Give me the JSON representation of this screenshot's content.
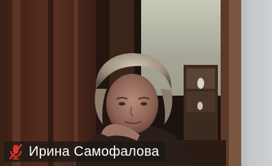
{
  "participant": {
    "name": "Ирина Самофалова",
    "mic_icon": "mic-muted-icon",
    "mic_color": "#e0312b"
  },
  "colors": {
    "background": "#1a1411",
    "label_text": "#ffffff"
  }
}
